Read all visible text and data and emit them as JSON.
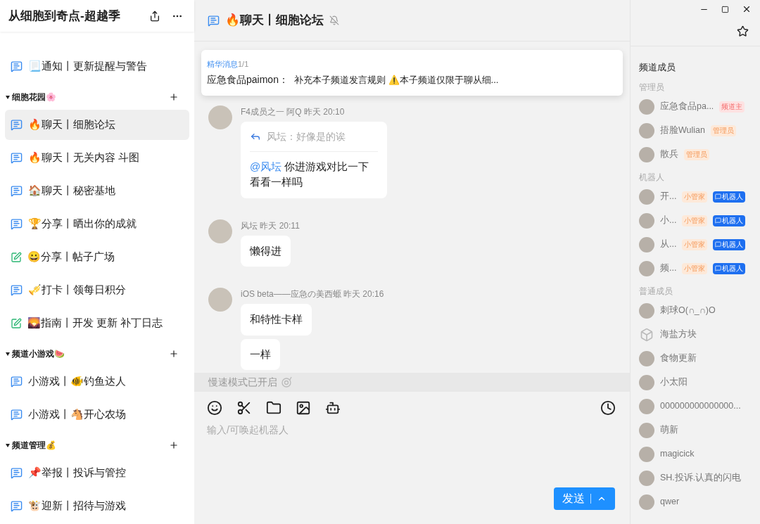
{
  "sidebar": {
    "title": "从细胞到奇点-超越季",
    "groups": [
      {
        "items": [
          {
            "label": "📃通知丨更新提醒与警告",
            "kind": "chat",
            "selected": false
          }
        ]
      },
      {
        "name": "细胞花园🌸",
        "items": [
          {
            "label": "🔥聊天丨细胞论坛",
            "kind": "chat",
            "selected": true
          },
          {
            "label": "🔥聊天丨无关内容 斗图",
            "kind": "chat",
            "selected": false
          },
          {
            "label": "🏠聊天丨秘密基地",
            "kind": "chat",
            "selected": false
          },
          {
            "label": "🏆分享丨晒出你的成就",
            "kind": "chat",
            "selected": false
          },
          {
            "label": "😀分享丨帖子广场",
            "kind": "post",
            "selected": false
          },
          {
            "label": "🎺打卡丨领每日积分",
            "kind": "chat",
            "selected": false
          },
          {
            "label": "🌄指南丨开发 更新 补丁日志",
            "kind": "post",
            "selected": false
          }
        ]
      },
      {
        "name": "频道小游戏🍉",
        "items": [
          {
            "label": "小游戏丨🐠钓鱼达人",
            "kind": "chat",
            "selected": false
          },
          {
            "label": "小游戏丨🐴开心农场",
            "kind": "chat",
            "selected": false
          }
        ]
      },
      {
        "name": "频道管理💰",
        "items": [
          {
            "label": "📌举报丨投诉与管控",
            "kind": "chat",
            "selected": false
          },
          {
            "label": "🐮迎新丨招待与游戏",
            "kind": "chat",
            "selected": false
          }
        ]
      }
    ]
  },
  "channel": {
    "title": "🔥聊天丨细胞论坛",
    "muted": true
  },
  "pinned": {
    "label": "精华消息",
    "count": "1/1",
    "author": "应急食品paimon：",
    "text": "补充本子频道发言规则 ⚠️本子频道仅限于聊从细..."
  },
  "messages": [
    {
      "meta": "F4成员之一 阿Q 昨天 20:10",
      "bubbles": [
        {
          "quote": "风坛：好像是的诶",
          "mention": "@风坛",
          "text": "你进游戏对比一下看看一样吗"
        }
      ]
    },
    {
      "meta": "风坛 昨天 20:11",
      "bubbles": [
        {
          "text": "懒得进"
        }
      ]
    },
    {
      "meta": "iOS beta——应急の美西螈 昨天 20:16",
      "bubbles": [
        {
          "text": "和特性卡样"
        },
        {
          "text": "一样"
        }
      ]
    }
  ],
  "slow_mode": "慢速模式已开启",
  "composer": {
    "placeholder": "输入/可唤起机器人",
    "send": "发送"
  },
  "members": {
    "title": "频道成员",
    "sections": [
      {
        "name": "管理员",
        "items": [
          {
            "name": "应急食品pa...",
            "tags": [
              {
                "kind": "owner",
                "text": "频道主"
              }
            ]
          },
          {
            "name": "捂脸Wulian",
            "tags": [
              {
                "kind": "admin",
                "text": "管理员"
              }
            ]
          },
          {
            "name": "散兵",
            "tags": [
              {
                "kind": "admin",
                "text": "管理员"
              }
            ]
          }
        ]
      },
      {
        "name": "机器人",
        "items": [
          {
            "name": "开...",
            "tags": [
              {
                "kind": "admin",
                "text": "小管家"
              },
              {
                "kind": "bot",
                "text": "机器人"
              }
            ]
          },
          {
            "name": "小...",
            "tags": [
              {
                "kind": "admin",
                "text": "小管家"
              },
              {
                "kind": "bot",
                "text": "机器人"
              }
            ]
          },
          {
            "name": "从...",
            "tags": [
              {
                "kind": "admin",
                "text": "小管家"
              },
              {
                "kind": "bot",
                "text": "机器人"
              }
            ]
          },
          {
            "name": "频...",
            "tags": [
              {
                "kind": "admin",
                "text": "小管家"
              },
              {
                "kind": "bot",
                "text": "机器人"
              }
            ]
          }
        ]
      },
      {
        "name": "普通成员",
        "items": [
          {
            "name": "刺球O(∩_∩)O",
            "default_avatar": false
          },
          {
            "name": "海盐方块",
            "default_avatar": true
          },
          {
            "name": "食物更新",
            "default_avatar": false
          },
          {
            "name": "小太阳",
            "default_avatar": false
          },
          {
            "name": "000000000000000...",
            "default_avatar": false
          },
          {
            "name": "萌新",
            "default_avatar": false
          },
          {
            "name": "magicick",
            "default_avatar": false
          },
          {
            "name": "SH.投诉.认真的闪电",
            "default_avatar": false
          },
          {
            "name": "qwer",
            "default_avatar": false
          }
        ]
      }
    ]
  }
}
